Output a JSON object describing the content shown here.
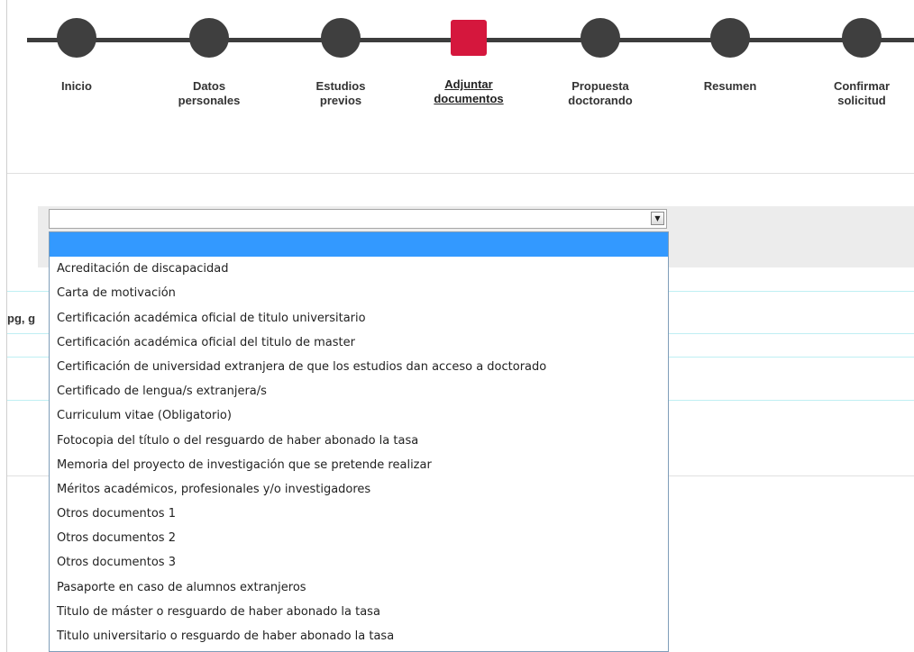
{
  "stepper": {
    "steps": [
      {
        "label_l1": "Inicio",
        "label_l2": ""
      },
      {
        "label_l1": "Datos",
        "label_l2": "personales"
      },
      {
        "label_l1": "Estudios",
        "label_l2": "previos"
      },
      {
        "label_l1": "Adjuntar",
        "label_l2": "documentos"
      },
      {
        "label_l1": "Propuesta",
        "label_l2": "doctorando"
      },
      {
        "label_l1": "Resumen",
        "label_l2": ""
      },
      {
        "label_l1": "Confirmar",
        "label_l2": "solicitud"
      }
    ],
    "active_step": "Adjuntar documentos"
  },
  "partial_text": "pg, g",
  "document_select": {
    "selected_value": "",
    "options": [
      "",
      "Acreditación de discapacidad",
      "Carta de motivación",
      "Certificación académica oficial de titulo universitario",
      "Certificación académica oficial del titulo de master",
      "Certificación de universidad extranjera de que los estudios dan acceso a doctorado",
      "Certificado de lengua/s extranjera/s",
      "Curriculum vitae (Obligatorio)",
      "Fotocopia del título o del resguardo de haber abonado la tasa",
      "Memoria del proyecto de investigación que se pretende realizar",
      "Méritos académicos, profesionales y/o investigadores",
      "Otros documentos 1",
      "Otros documentos 2",
      "Otros documentos 3",
      "Pasaporte en caso de alumnos extranjeros",
      "Titulo de máster o resguardo de haber abonado la tasa",
      "Titulo universitario o resguardo de haber abonado la tasa"
    ]
  },
  "colors": {
    "active_step": "#d5173d",
    "inactive_step": "#3f3f3f",
    "highlight": "#3399ff"
  }
}
